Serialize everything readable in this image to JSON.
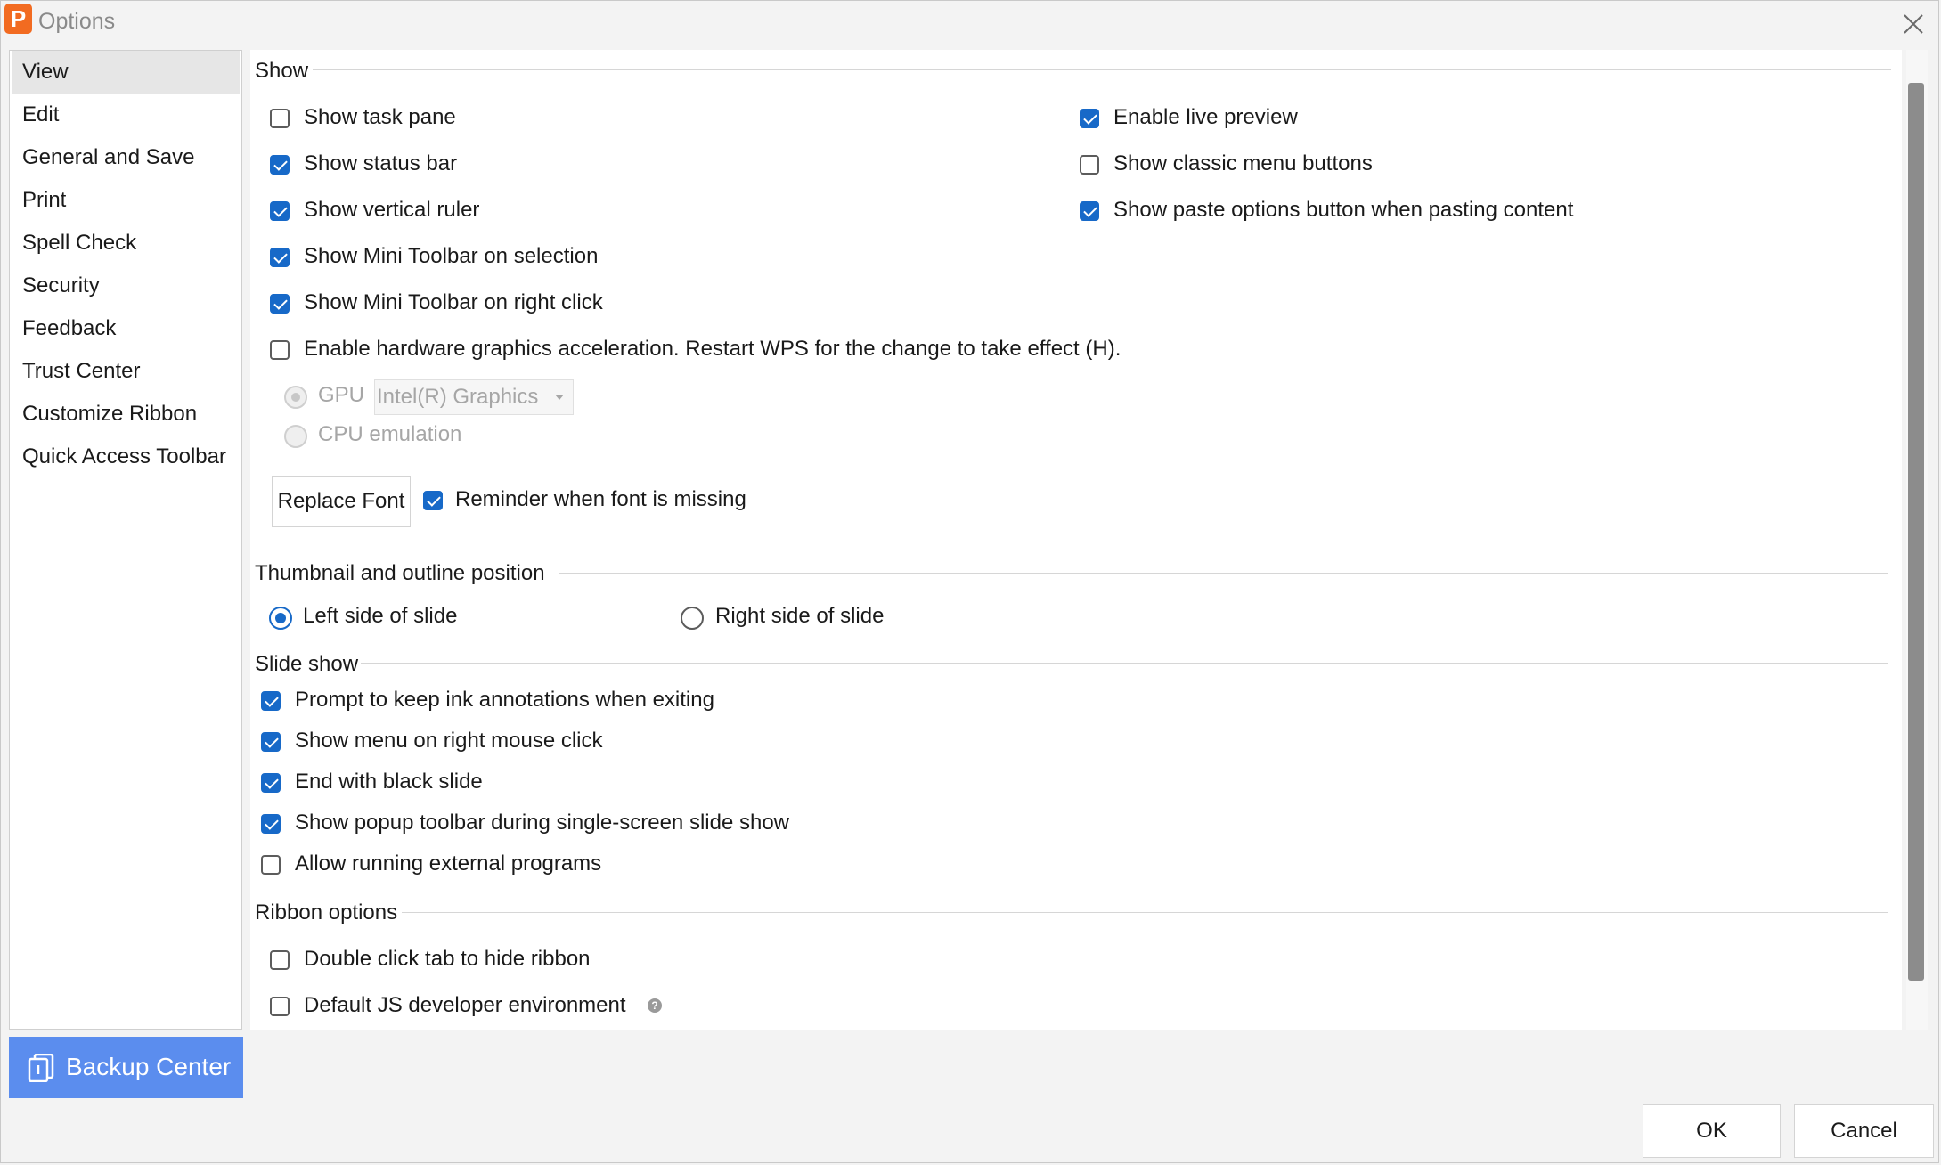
{
  "window": {
    "title": "Options",
    "app_letter": "P"
  },
  "nav": {
    "items": [
      {
        "label": "View"
      },
      {
        "label": "Edit"
      },
      {
        "label": "General and Save"
      },
      {
        "label": "Print"
      },
      {
        "label": "Spell Check"
      },
      {
        "label": "Security"
      },
      {
        "label": "Feedback"
      },
      {
        "label": "Trust Center"
      },
      {
        "label": "Customize Ribbon"
      },
      {
        "label": "Quick Access Toolbar"
      }
    ],
    "selected": "View",
    "backup_label": "Backup Center"
  },
  "show": {
    "header": "Show",
    "left": [
      {
        "label": "Show task pane",
        "checked": false
      },
      {
        "label": "Show status bar",
        "checked": true
      },
      {
        "label": "Show vertical ruler",
        "checked": true
      },
      {
        "label": "Show Mini Toolbar on selection",
        "checked": true
      },
      {
        "label": "Show Mini Toolbar on right click",
        "checked": true
      },
      {
        "label": "Enable hardware graphics acceleration. Restart WPS for the change to take effect (H).",
        "checked": false
      }
    ],
    "right": [
      {
        "label": "Enable live preview",
        "checked": true
      },
      {
        "label": "Show classic menu buttons",
        "checked": false
      },
      {
        "label": "Show paste options button when pasting content",
        "checked": true
      }
    ],
    "gpu_label": "GPU",
    "gpu_value": "Intel(R) Graphics",
    "cpu_label": "CPU emulation",
    "replace_font_label": "Replace Font",
    "reminder_label": "Reminder when font is missing",
    "reminder_checked": true
  },
  "thumbnail": {
    "header": "Thumbnail and outline position",
    "options": [
      {
        "label": "Left side of slide",
        "selected": true
      },
      {
        "label": "Right side of slide",
        "selected": false
      }
    ]
  },
  "slideshow": {
    "header": "Slide show",
    "items": [
      {
        "label": "Prompt to keep ink annotations when exiting",
        "checked": true
      },
      {
        "label": "Show menu on right mouse click",
        "checked": true
      },
      {
        "label": "End with black slide",
        "checked": true
      },
      {
        "label": "Show popup toolbar during single-screen slide show",
        "checked": true
      },
      {
        "label": "Allow running external programs",
        "checked": false
      }
    ]
  },
  "ribbon": {
    "header": "Ribbon options",
    "items": [
      {
        "label": "Double click tab to hide ribbon",
        "checked": false
      },
      {
        "label": "Default JS developer environment",
        "checked": false
      }
    ],
    "help_glyph": "?"
  },
  "footer": {
    "ok_label": "OK",
    "cancel_label": "Cancel"
  },
  "colors": {
    "accent": "#1769c8",
    "backup_bg": "#5b8dee",
    "app_logo": "#f26b21"
  }
}
